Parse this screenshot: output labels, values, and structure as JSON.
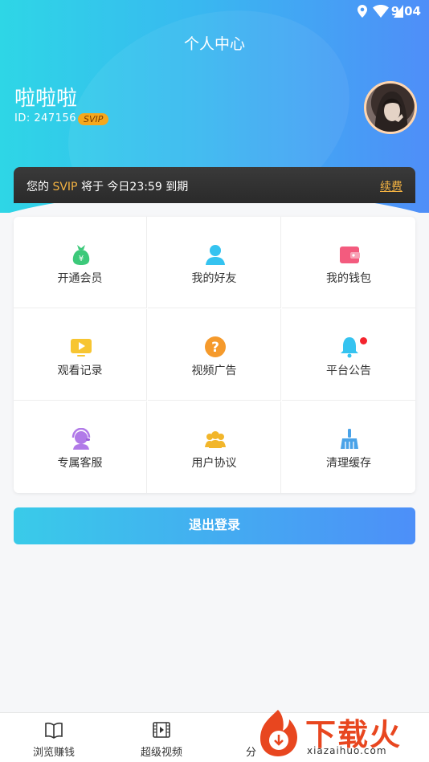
{
  "status_bar": {
    "time": "9:04"
  },
  "header": {
    "title": "个人中心",
    "username": "啦啦啦",
    "id_label": "ID: 247156",
    "badge": "SVIP"
  },
  "vip_notice": {
    "prefix": "您的",
    "level": "SVIP",
    "mid": "将于",
    "expiry": "今日23:59",
    "suffix": "到期",
    "renew_label": "续费"
  },
  "menu": {
    "items": [
      {
        "label": "开通会员",
        "icon": "money-bag-icon",
        "color": "#3cc97a"
      },
      {
        "label": "我的好友",
        "icon": "user-icon",
        "color": "#35c3f0"
      },
      {
        "label": "我的钱包",
        "icon": "wallet-icon",
        "color": "#f35b7e"
      },
      {
        "label": "观看记录",
        "icon": "tv-play-icon",
        "color": "#f7c531"
      },
      {
        "label": "视频广告",
        "icon": "question-icon",
        "color": "#f59a2c"
      },
      {
        "label": "平台公告",
        "icon": "bell-icon",
        "color": "#35c3f0"
      },
      {
        "label": "专属客服",
        "icon": "headset-icon",
        "color": "#b17ae8"
      },
      {
        "label": "用户协议",
        "icon": "group-icon",
        "color": "#f2b62b"
      },
      {
        "label": "清理缓存",
        "icon": "broom-icon",
        "color": "#4aa3e8"
      }
    ]
  },
  "logout_label": "退出登录",
  "tabs": [
    {
      "label": "浏览赚钱",
      "icon": "book-icon"
    },
    {
      "label": "超级视频",
      "icon": "film-icon"
    },
    {
      "label": "分",
      "icon": "share-icon"
    }
  ],
  "watermark": {
    "brand": "下载火",
    "url": "xiazaihuo.com"
  }
}
